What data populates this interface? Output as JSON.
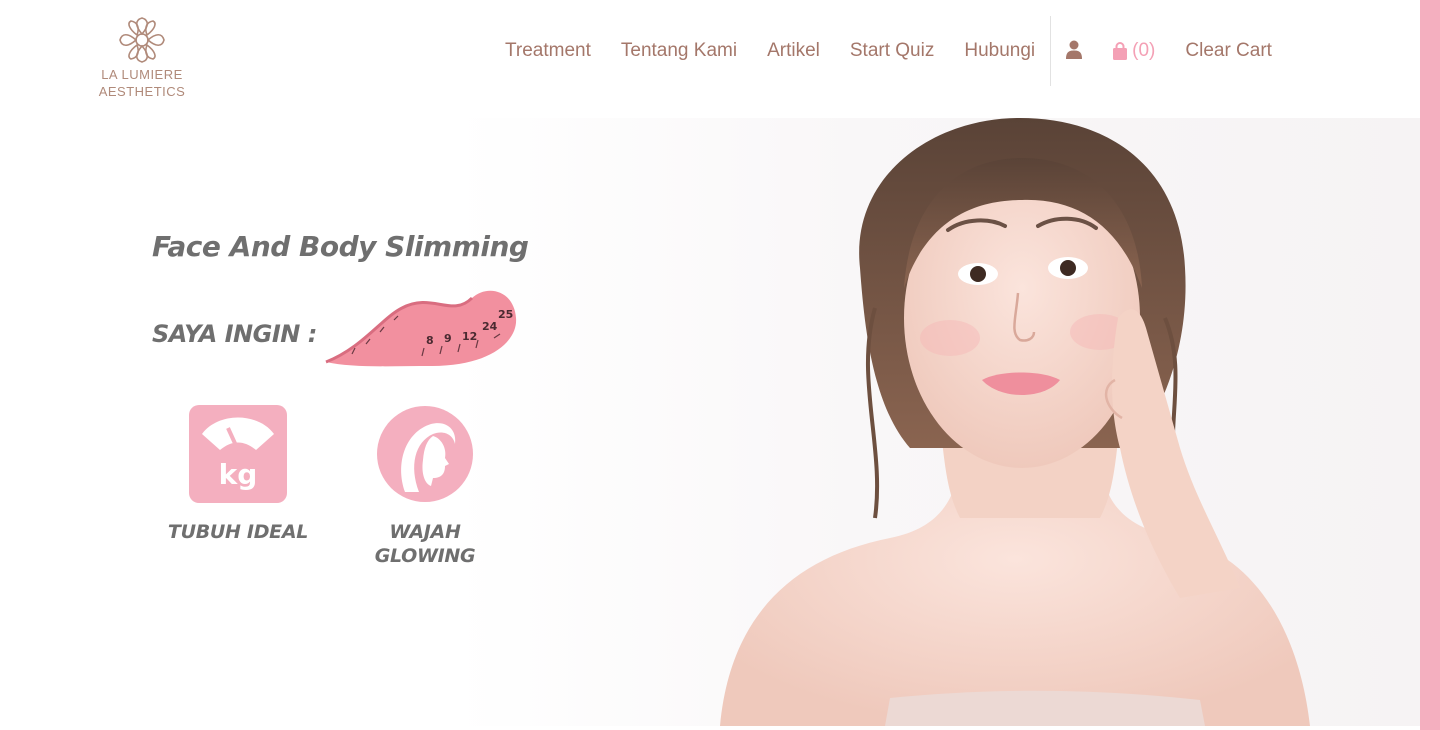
{
  "logo": {
    "line1": "LA LUMIERE",
    "line2": "AESTHETICS"
  },
  "nav": {
    "items": [
      {
        "label": "Treatment"
      },
      {
        "label": "Tentang Kami"
      },
      {
        "label": "Artikel"
      },
      {
        "label": "Start Quiz"
      },
      {
        "label": "Hubungi"
      }
    ],
    "cart_count": "(0)",
    "clear_cart": "Clear Cart"
  },
  "hero": {
    "title": "Face And Body Slimming",
    "want_label": "SAYA INGIN :",
    "options": [
      {
        "label": "TUBUH IDEAL",
        "icon": "weight-scale-kg-icon",
        "icon_text": "kg"
      },
      {
        "label_line1": "WAJAH",
        "label_line2": "GLOWING",
        "icon": "woman-face-icon"
      }
    ]
  },
  "colors": {
    "brand_brown": "#a4776a",
    "accent_pink": "#f4afbf",
    "text_gray": "#6f6f6f"
  }
}
